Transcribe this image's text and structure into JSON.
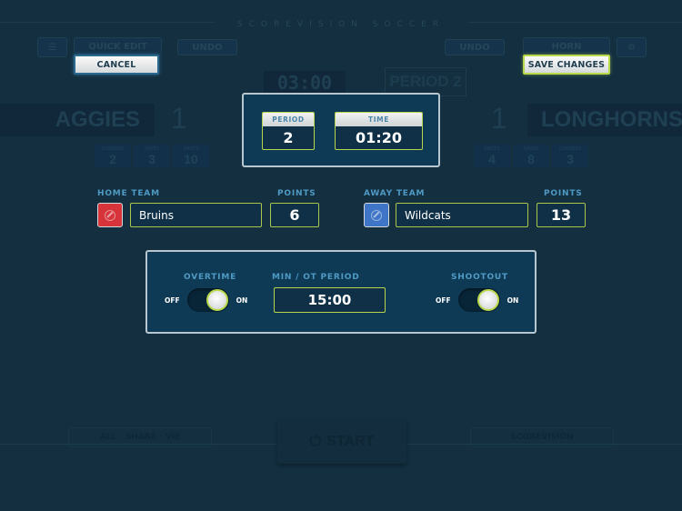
{
  "background": {
    "brand": "SCOREVISION SOCCER",
    "menu_icon": "hamburger-icon",
    "quick_edit_label": "QUICK EDIT",
    "undo_left_label": "UNDO",
    "undo_right_label": "UNDO",
    "horn_label": "HORN",
    "settings_icon": "gear-icon",
    "clock": "03:00",
    "period": "PERIOD 2",
    "home": {
      "name": "AGGIES",
      "score": "1",
      "stats": [
        {
          "label": "CORNERS",
          "value": "2"
        },
        {
          "label": "SAVES",
          "value": "3"
        },
        {
          "label": "SHOTS",
          "value": "10"
        }
      ]
    },
    "away": {
      "name": "LONGHORNS",
      "score": "1",
      "stats": [
        {
          "label": "SHOTS",
          "value": "4"
        },
        {
          "label": "SAVES",
          "value": "8"
        },
        {
          "label": "CORNERS",
          "value": "3"
        }
      ]
    },
    "start_label": "START",
    "bottom_left_label": "ALL  ·  SHARE  ·  VIE",
    "bottom_right_label": "SCOREVISION"
  },
  "actions": {
    "cancel_label": "CANCEL",
    "save_label": "SAVE CHANGES"
  },
  "clock_panel": {
    "period_label": "PERIOD",
    "period_value": "2",
    "time_label": "TIME",
    "time_value": "01:20"
  },
  "home_team": {
    "section_label": "HOME TEAM",
    "name": "Bruins",
    "color": "#d6333a",
    "color_icon": "color-picker-icon",
    "points_label": "POINTS",
    "points": "6"
  },
  "away_team": {
    "section_label": "AWAY TEAM",
    "name": "Wildcats",
    "color": "#3f75c6",
    "color_icon": "color-picker-icon",
    "points_label": "POINTS",
    "points": "13"
  },
  "overtime_panel": {
    "overtime_label": "OVERTIME",
    "overtime_state": "on",
    "min_ot_label": "MIN / OT PERIOD",
    "min_ot_value": "15:00",
    "shootout_label": "SHOOTOUT",
    "shootout_state": "on",
    "off_label": "OFF",
    "on_label": "ON"
  },
  "colors": {
    "background": "#132f40",
    "panel": "#0e3a55",
    "accent_green": "#b6d54c",
    "label_blue": "#4f9ac4"
  }
}
